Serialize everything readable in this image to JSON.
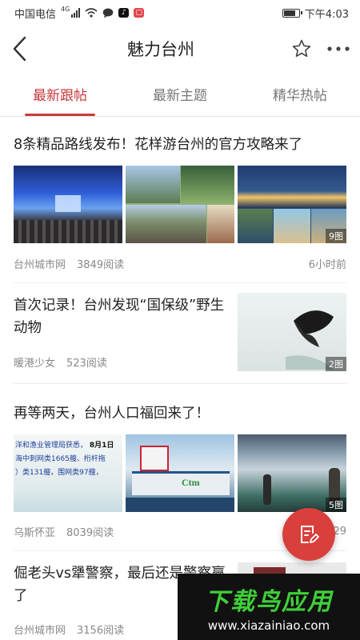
{
  "status_bar": {
    "carrier": "中国电信",
    "network": "4G",
    "time": "下午4:03",
    "battery_level": 0.85
  },
  "header": {
    "title": "魅力台州",
    "back_icon": "chevron-left-icon",
    "favorite_icon": "star-icon",
    "more_icon": "more-icon"
  },
  "tabs": [
    {
      "label": "最新跟帖",
      "active": true
    },
    {
      "label": "最新主题",
      "active": false
    },
    {
      "label": "精华热帖",
      "active": false
    }
  ],
  "posts": [
    {
      "title": "8条精品路线发布！花样游台州的官方攻略来了",
      "source": "台州城市网",
      "reads": "3849阅读",
      "time": "6小时前",
      "image_count": "9图"
    },
    {
      "title": "首次记录！台州发现“国保级”野生动物",
      "source": "暖港少女",
      "reads": "523阅读",
      "image_count": "2图"
    },
    {
      "title": "再等两天，台州人口福回来了！",
      "source": "乌斯怀亚",
      "reads": "8039阅读",
      "time": "29",
      "image_count": "5图",
      "thumb_text": {
        "line1": "洋和渔业管理局获悉，",
        "date": "8月1日",
        "line2": "海中刺网类1665艘、桁杆拖",
        "line3": "）类131艘，围网类97艘，"
      },
      "boat_text": "Ctm"
    },
    {
      "title": "倔老头vs犟警察，最后还是警察赢了",
      "source": "台州城市网",
      "reads": "3156阅读"
    }
  ],
  "watermark": {
    "logo": "下载鸟应用",
    "url": "www.xiazainiao.com"
  }
}
